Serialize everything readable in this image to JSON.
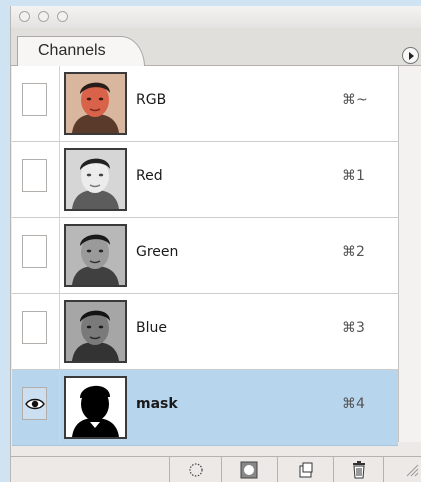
{
  "panel": {
    "title": "Channels"
  },
  "channels": [
    {
      "name": "RGB",
      "shortcut": "⌘~",
      "visible": false,
      "selected": false,
      "thumb": "color"
    },
    {
      "name": "Red",
      "shortcut": "⌘1",
      "visible": false,
      "selected": false,
      "thumb": "light"
    },
    {
      "name": "Green",
      "shortcut": "⌘2",
      "visible": false,
      "selected": false,
      "thumb": "mid"
    },
    {
      "name": "Blue",
      "shortcut": "⌘3",
      "visible": false,
      "selected": false,
      "thumb": "dark"
    },
    {
      "name": "mask",
      "shortcut": "⌘4",
      "visible": true,
      "selected": true,
      "thumb": "mask"
    }
  ],
  "colors": {
    "selected_row": "#b8d5ee",
    "background": "#cfe3f3"
  },
  "icons": {
    "load_selection": "dotted-circle-icon",
    "save_selection": "mask-circle-icon",
    "new_channel": "new-page-icon",
    "delete": "trash-icon"
  }
}
